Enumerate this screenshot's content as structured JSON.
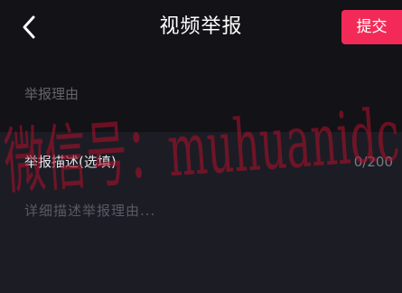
{
  "nav": {
    "title": "视频举报",
    "back_icon": "chevron-left-icon",
    "submit_label": "提交"
  },
  "colors": {
    "accent": "#f32a57",
    "background": "#17171e",
    "watermark": "#b3112a"
  },
  "report_reason": {
    "label": "举报理由"
  },
  "report_description": {
    "label": "举报描述(选填)",
    "char_count": "0/200",
    "value": "",
    "placeholder": "详细描述举报理由..."
  },
  "watermark": {
    "text": "微信号：muhuanidc"
  }
}
